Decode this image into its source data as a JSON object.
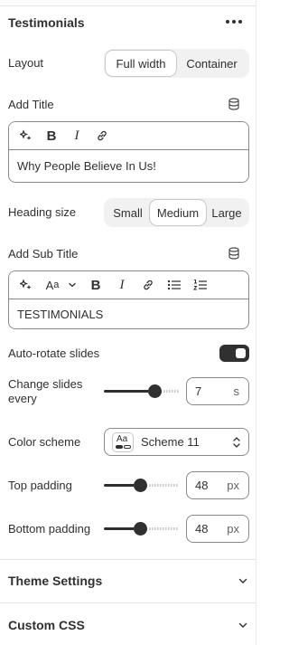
{
  "section": {
    "title": "Testimonials"
  },
  "layout": {
    "label": "Layout",
    "options": [
      "Full width",
      "Container"
    ],
    "selected": "Full width"
  },
  "add_title": {
    "label": "Add Title",
    "value": "Why People Believe In Us!",
    "toolbar": [
      "magic-icon",
      "bold-icon",
      "italic-icon",
      "link-icon"
    ]
  },
  "heading_size": {
    "label": "Heading size",
    "options": [
      "Small",
      "Medium",
      "Large"
    ],
    "selected": "Medium"
  },
  "add_subtitle": {
    "label": "Add Sub Title",
    "value": "TESTIMONIALS",
    "toolbar": [
      "magic-icon",
      "text-style-icon",
      "chevron-down-icon",
      "bold-icon",
      "italic-icon",
      "link-icon",
      "bullet-list-icon",
      "numbered-list-icon"
    ]
  },
  "autorotate": {
    "label": "Auto-rotate slides",
    "on": true
  },
  "change_slides": {
    "label_line1": "Change slides",
    "label_line2": "every",
    "value": "7",
    "unit": "s",
    "min": 2,
    "max": 9
  },
  "color_scheme": {
    "label": "Color scheme",
    "value": "Scheme 11",
    "swatch_glyph": "Aa"
  },
  "top_padding": {
    "label": "Top padding",
    "value": "48",
    "unit": "px",
    "min": 0,
    "max": 100
  },
  "bottom_padding": {
    "label": "Bottom padding",
    "value": "48",
    "unit": "px",
    "min": 0,
    "max": 100
  },
  "accordions": {
    "theme": "Theme Settings",
    "css": "Custom CSS"
  },
  "colors": {
    "text": "#303030",
    "border": "#8a8a8a",
    "segment_bg": "#f1f1f1",
    "toggle_on": "#303030"
  }
}
